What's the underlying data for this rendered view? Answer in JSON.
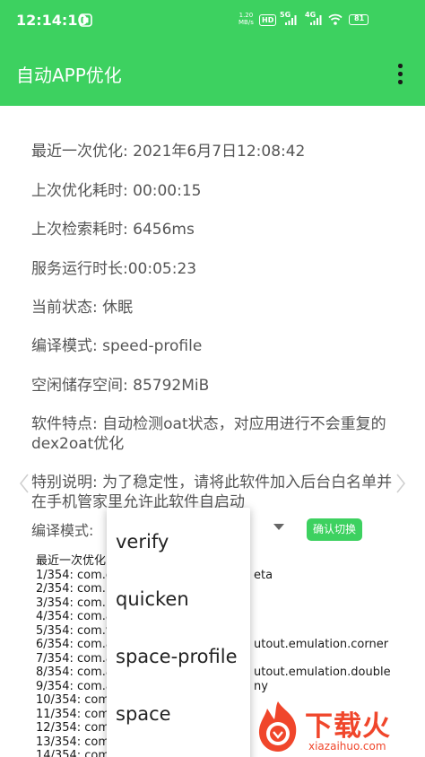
{
  "status_bar": {
    "time": "12:14:10",
    "net_speed_value": "1.20",
    "net_speed_unit": "MB/s",
    "hd_badge": "HD",
    "sim1_label": "5G",
    "sim2_label": "4G",
    "battery_level": "81",
    "background_color": "#3dd160"
  },
  "app_bar": {
    "title": "自动APP优化",
    "menu_icon": "more-vertical-icon"
  },
  "info": {
    "last_optimize": "最近一次优化: 2021年6月7日12:08:42",
    "optimize_duration": "上次优化耗时: 00:00:15",
    "search_duration": "上次检索耗时: 6456ms",
    "service_uptime": "服务运行时长:00:05:23",
    "current_state": "当前状态: 休眠",
    "compile_mode": "编译模式: speed-profile",
    "free_storage": "空闲储存空间: 85792MiB",
    "features": "软件特点: 自动检测oat状态，对应用进行不会重复的dex2oat优化",
    "special_note": "特别说明: 为了稳定性，请将此软件加入后台白名单并在手机管家里允许此软件自启动"
  },
  "mode_selector": {
    "label": "编译模式:",
    "confirm_label": "确认切换"
  },
  "log": {
    "header": "最近一次优化",
    "entries": [
      "1/354: com.g",
      "2/354: com.n",
      "3/354: com.n",
      "4/354: com.a",
      "5/354: com.v",
      "6/354: com.a",
      "7/354: com.a",
      "8/354: com.a",
      "9/354: com.a",
      "10/354: com",
      "11/354: com",
      "12/354: com",
      "13/354: com",
      "14/354: com"
    ],
    "tails": {
      "line1": "eta",
      "line6": "utout.emulation.corner",
      "line8": "utout.emulation.double",
      "line9": "ny"
    }
  },
  "dropdown": {
    "options": [
      "verify",
      "quicken",
      "space-profile",
      "space"
    ]
  },
  "watermark": {
    "title": "下载火",
    "subtitle": "xiazaihuo.com"
  },
  "colors": {
    "accent": "#3dd160",
    "text": "#555555",
    "watermark": "#f0462b"
  }
}
